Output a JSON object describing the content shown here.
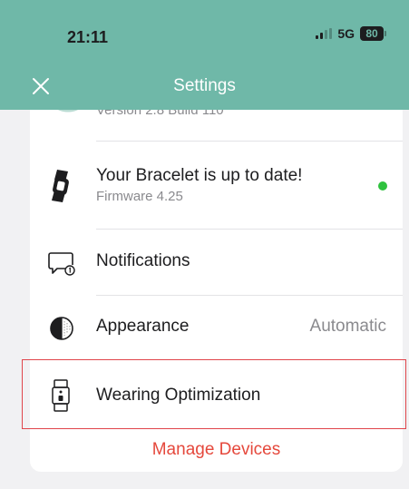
{
  "status_bar": {
    "time": "21:11",
    "network": "5G",
    "battery": "80"
  },
  "header": {
    "title": "Settings",
    "close_icon": "close-icon"
  },
  "app_row": {
    "version": "Version 2.8 Build 110"
  },
  "firmware_row": {
    "title": "Your Bracelet is up to date!",
    "subtitle": "Firmware 4.25",
    "status_color": "#2fc23e"
  },
  "notifications_row": {
    "label": "Notifications"
  },
  "appearance_row": {
    "label": "Appearance",
    "value": "Automatic"
  },
  "wearing_row": {
    "label": "Wearing Optimization"
  },
  "manage_devices": {
    "label": "Manage Devices"
  },
  "colors": {
    "header_bg": "#6fb8a8",
    "accent_red": "#e5483c",
    "highlight_border": "#e0454b"
  }
}
